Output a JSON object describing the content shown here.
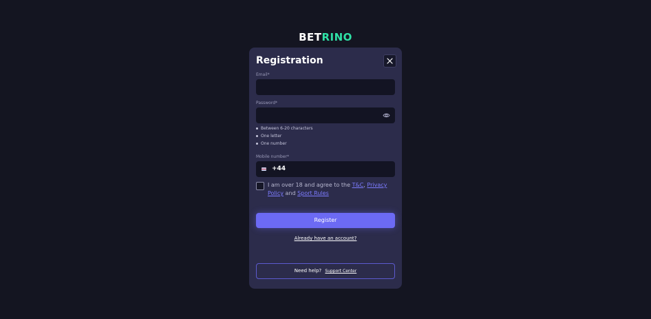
{
  "brand": {
    "logo_part1": "BET",
    "logo_part2": "RINO"
  },
  "form": {
    "title": "Registration",
    "email_label": "Email*",
    "email_value": "",
    "password_label": "Password*",
    "password_value": "",
    "password_rules": [
      "Between 6-20 characters",
      "One letter",
      "One number"
    ],
    "mobile_label": "Mobile number*",
    "mobile_code": "+44",
    "agree_prefix": "I am over 18 and agree to the ",
    "tc_link": "T&C",
    "sep": ", ",
    "privacy_link": "Privacy Policy",
    "and_text": " and ",
    "sport_rules_link": "Sport Rules",
    "register_label": "Register",
    "login_link": "Already have an account?",
    "help_text": "Need help?",
    "support_link": "Support Center"
  },
  "colors": {
    "background": "#141521",
    "card": "#2c2c4b",
    "accent": "#6c6af4",
    "brand_green": "#2fe1a6"
  },
  "icons": {
    "close": "close-icon",
    "eye": "eye-icon",
    "flag": "uk-flag-icon"
  }
}
